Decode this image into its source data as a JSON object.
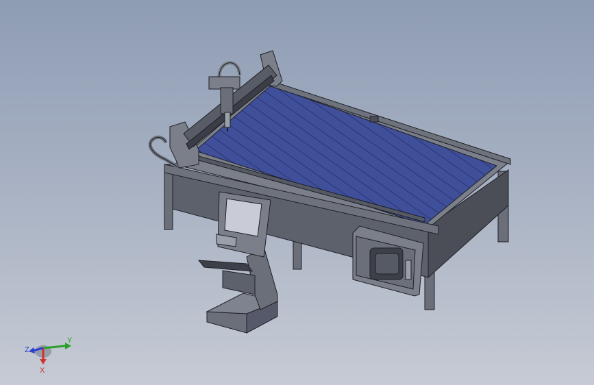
{
  "scene": {
    "subject": "plasma-cutting-table",
    "colors": {
      "background_top": "#8e9cb4",
      "background_bottom": "#c6cbd4",
      "bed": "#3f4f9a",
      "frame": "#6b6f7a",
      "frame_dark": "#4b4e57",
      "outline": "#1e1f24"
    }
  },
  "triad": {
    "x_label": "X",
    "y_label": "Y",
    "z_label": "Z",
    "x_color": "#d03030",
    "y_color": "#2aa02a",
    "z_color": "#2a3fd0"
  }
}
